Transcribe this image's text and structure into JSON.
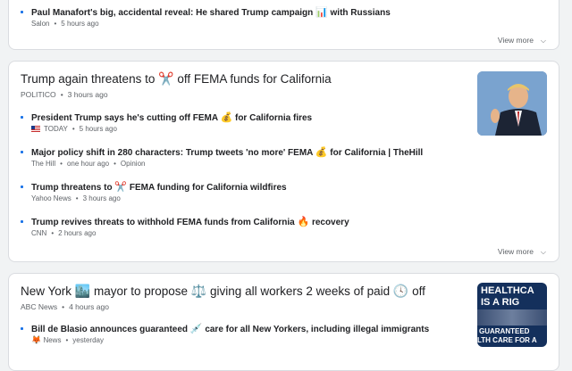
{
  "card1": {
    "stories": [
      {
        "title": "Paul Manafort's big, accidental reveal: He shared Trump campaign",
        "emoji": "📊",
        "title_end": "with Russians",
        "source": "Salon",
        "time": "5 hours ago"
      }
    ],
    "view_more": "View more"
  },
  "card2": {
    "headline_start": "Trump again threatens to",
    "headline_emoji": "✂️",
    "headline_end": "off FEMA funds for California",
    "source": "POLITICO",
    "time": "3 hours ago",
    "image_icon": "person-photo",
    "stories": [
      {
        "title": "President Trump says he's cutting off FEMA",
        "emoji": "💰",
        "title_end": "for California fires",
        "source": "TODAY",
        "source_icon": "us-flag-icon",
        "time": "5 hours ago",
        "extra": ""
      },
      {
        "title": "Major policy shift in 280 characters: Trump tweets 'no more' FEMA",
        "emoji": "💰",
        "title_end": "for California | TheHill",
        "source": "The Hill",
        "time": "one hour ago",
        "extra": "Opinion"
      },
      {
        "title": "Trump threatens to",
        "emoji": "✂️",
        "title_end": "FEMA funding for California wildfires",
        "source": "Yahoo News",
        "time": "3 hours ago",
        "extra": ""
      },
      {
        "title": "Trump revives threats to withhold FEMA funds from California",
        "emoji": "🔥",
        "title_end": "recovery",
        "source": "CNN",
        "time": "2 hours ago",
        "extra": ""
      }
    ],
    "view_more": "View more"
  },
  "card3": {
    "headline_start": "New York",
    "headline_emoji1": "🏙️",
    "headline_mid": "mayor to propose",
    "headline_emoji2": "⚖️",
    "headline_mid2": "giving all workers 2 weeks of paid",
    "headline_emoji3": "🕓",
    "headline_end": "off",
    "source": "ABC News",
    "time": "4 hours ago",
    "image_text": [
      "HEALTHCA",
      "IS A RIG",
      "GUARANTEED",
      "LTH CARE FOR A"
    ],
    "stories": [
      {
        "title": "Bill de Blasio announces guaranteed",
        "emoji": "💉",
        "title_end": "care for all New Yorkers, including illegal immigrants",
        "source_emoji": "🦊",
        "source": "News",
        "time": "yesterday"
      }
    ]
  },
  "colors": {
    "bullet": "#1a73e8",
    "meta": "#5f6368",
    "border": "#dadce0"
  }
}
